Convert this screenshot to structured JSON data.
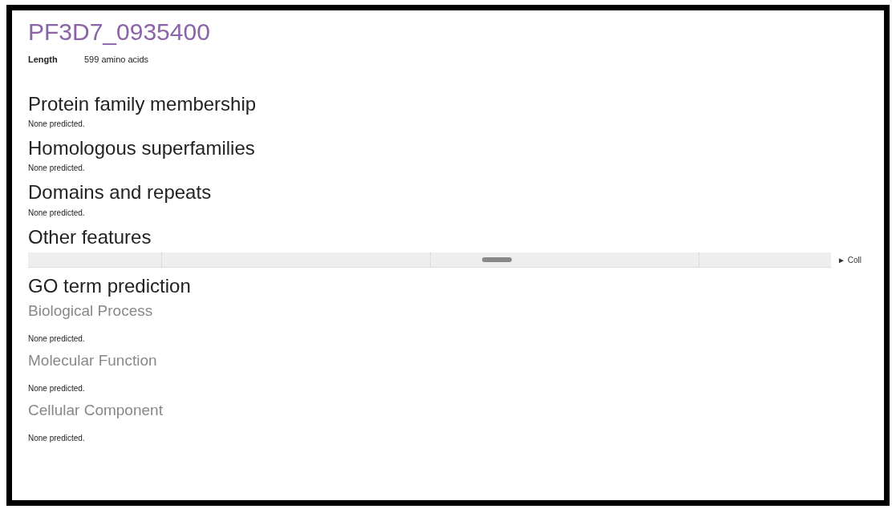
{
  "title": "PF3D7_0935400",
  "length": {
    "label": "Length",
    "value": "599 amino acids"
  },
  "sections": [
    {
      "kind": "text",
      "heading": "Protein family membership",
      "text": "None predicted."
    },
    {
      "kind": "text",
      "heading": "Homologous superfamilies",
      "text": "None predicted."
    },
    {
      "kind": "text",
      "heading": "Domains and repeats",
      "text": "None predicted."
    },
    {
      "kind": "track",
      "heading": "Other features",
      "toggle": "► Coll"
    },
    {
      "kind": "go",
      "heading": "GO term prediction",
      "subsections": [
        {
          "heading": "Biological Process",
          "text": "None predicted."
        },
        {
          "heading": "Molecular Function",
          "text": "None predicted."
        },
        {
          "heading": "Cellular Component",
          "text": "None predicted."
        }
      ]
    }
  ]
}
